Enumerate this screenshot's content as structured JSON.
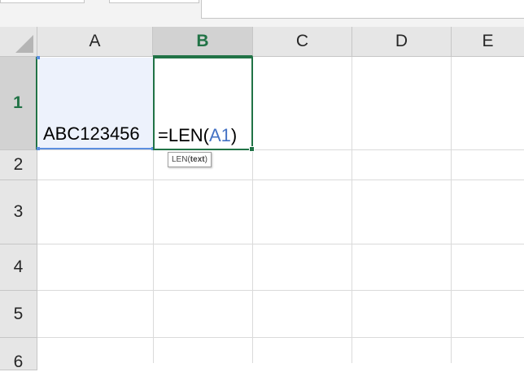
{
  "columns": [
    {
      "label": "A"
    },
    {
      "label": "B"
    },
    {
      "label": "C"
    },
    {
      "label": "D"
    },
    {
      "label": "E"
    }
  ],
  "rows": [
    {
      "label": "1"
    },
    {
      "label": "2"
    },
    {
      "label": "3"
    },
    {
      "label": "4"
    },
    {
      "label": "5"
    },
    {
      "label": "6"
    }
  ],
  "active_cell": "B1",
  "cells": {
    "A1": "ABC123456",
    "B1": {
      "prefix": "=LEN(",
      "reference": "A1",
      "suffix": ")"
    }
  },
  "tooltip": {
    "function_name": "LEN(",
    "argument": "text",
    "close": ")"
  },
  "colors": {
    "accent_green": "#217346",
    "reference_blue": "#4472c4",
    "reference_fill": "#edf2fc"
  }
}
